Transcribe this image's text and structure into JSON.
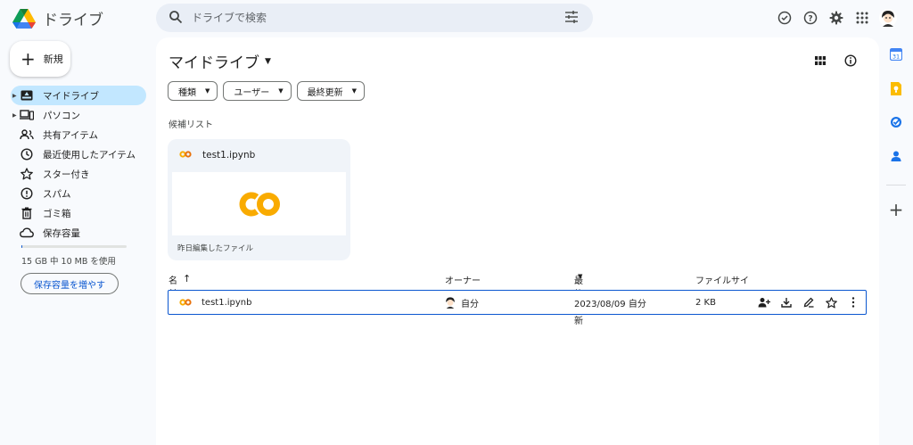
{
  "header": {
    "app_name": "ドライブ",
    "search_placeholder": "ドライブで検索"
  },
  "sidebar": {
    "new_label": "新規",
    "items": [
      {
        "label": "マイドライブ",
        "active": true,
        "caret": true,
        "icon": "my-drive-icon"
      },
      {
        "label": "パソコン",
        "active": false,
        "caret": true,
        "icon": "computer-icon"
      },
      {
        "label": "共有アイテム",
        "active": false,
        "caret": false,
        "icon": "shared-icon"
      },
      {
        "label": "最近使用したアイテム",
        "active": false,
        "caret": false,
        "icon": "clock-icon"
      },
      {
        "label": "スター付き",
        "active": false,
        "caret": false,
        "icon": "star-icon"
      },
      {
        "label": "スパム",
        "active": false,
        "caret": false,
        "icon": "spam-icon"
      },
      {
        "label": "ゴミ箱",
        "active": false,
        "caret": false,
        "icon": "trash-icon"
      },
      {
        "label": "保存容量",
        "active": false,
        "caret": false,
        "icon": "cloud-icon"
      }
    ],
    "storage_text": "15 GB 中 10 MB を使用",
    "storage_fraction": 0.01,
    "storage_button": "保存容量を増やす"
  },
  "main": {
    "title": "マイドライブ",
    "filters": [
      "種類",
      "ユーザー",
      "最終更新"
    ],
    "suggested_label": "候補リスト",
    "suggested_card": {
      "file_name": "test1.ipynb",
      "footer": "昨日編集したファイル"
    },
    "table": {
      "columns": {
        "name": "名前",
        "owner": "オーナー",
        "modified": "最終更新",
        "size": "ファイルサイ"
      },
      "rows": [
        {
          "name": "test1.ipynb",
          "owner": "自分",
          "modified": "2023/08/09 自分",
          "size": "2 KB"
        }
      ]
    }
  },
  "colors": {
    "accent": "#0b57d0",
    "active_nav": "#c2e7ff",
    "colab_orange": "#f9ab00"
  }
}
